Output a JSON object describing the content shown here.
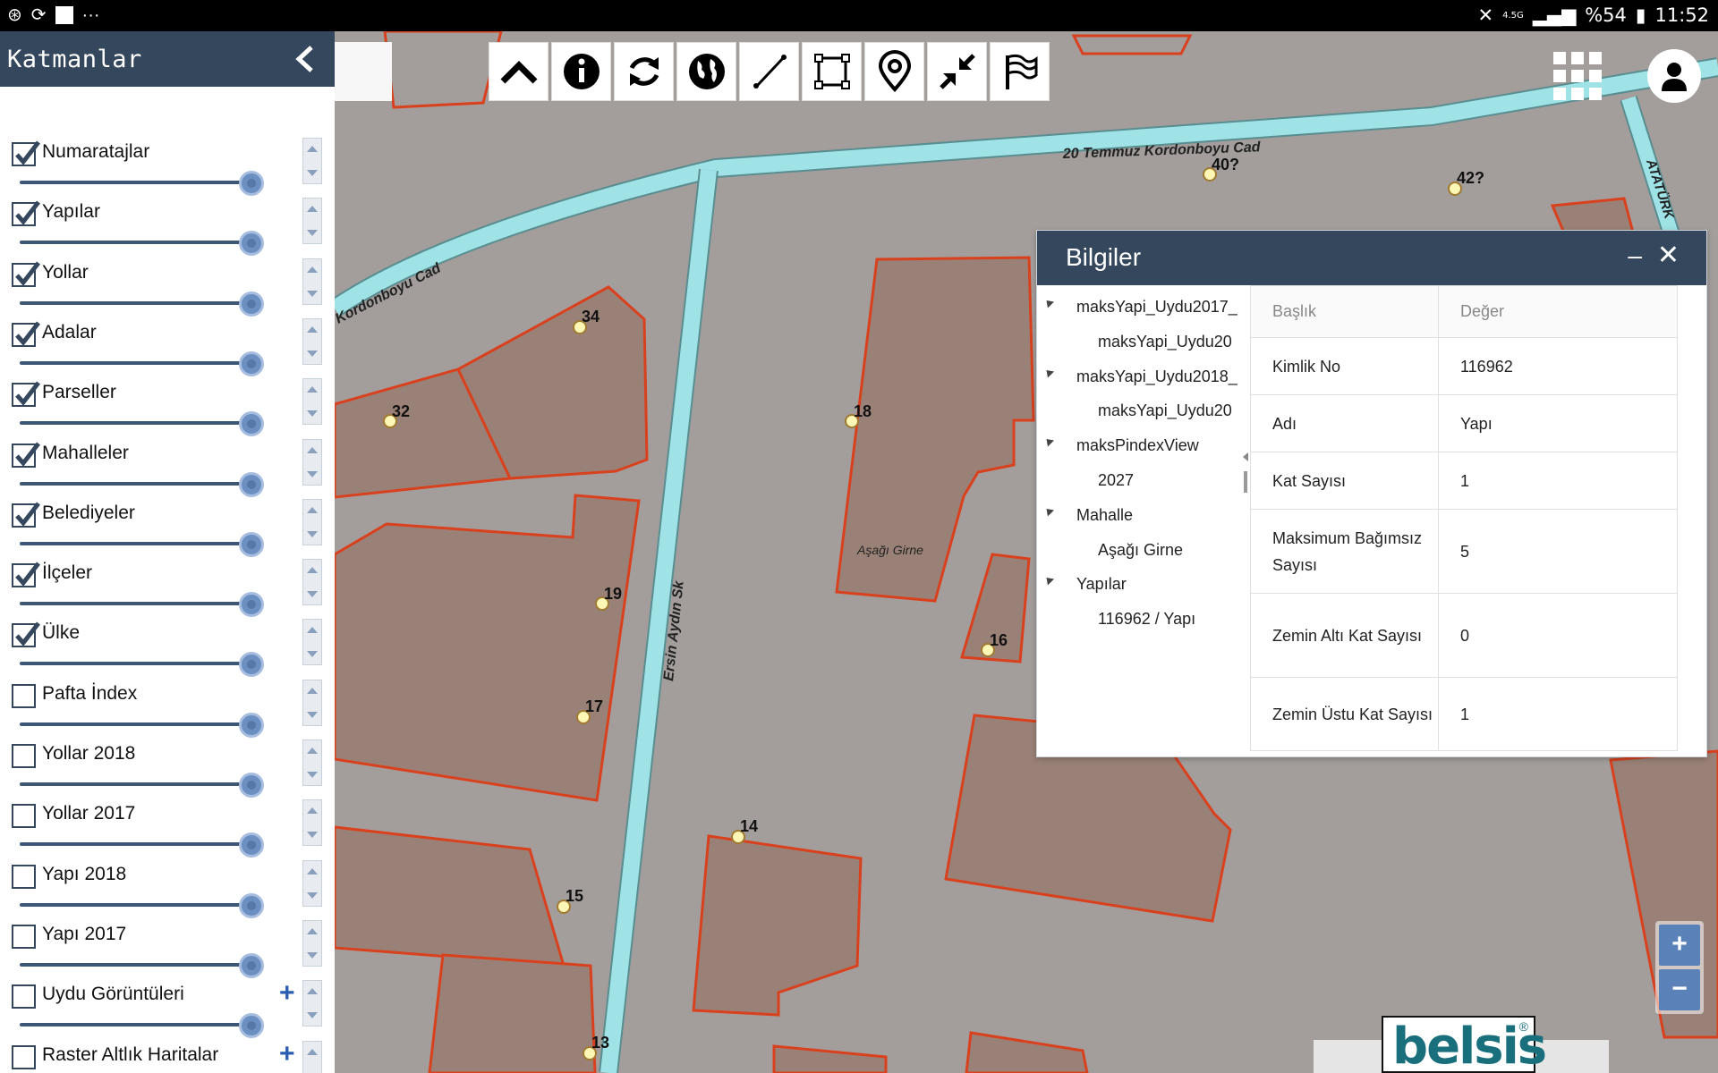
{
  "status_bar": {
    "left_icons": [
      "tethering-icon",
      "sync-icon",
      "flipboard-icon",
      "more-icon"
    ],
    "network": "4.5G",
    "battery": "%54",
    "time": "11:52"
  },
  "layers_panel": {
    "title": "Katmanlar",
    "items": [
      {
        "label": "Numaratajlar",
        "checked": true
      },
      {
        "label": "Yapılar",
        "checked": true
      },
      {
        "label": "Yollar",
        "checked": true
      },
      {
        "label": "Adalar",
        "checked": true
      },
      {
        "label": "Parseller",
        "checked": true
      },
      {
        "label": "Mahalleler",
        "checked": true
      },
      {
        "label": "Belediyeler",
        "checked": true
      },
      {
        "label": "İlçeler",
        "checked": true
      },
      {
        "label": "Ülke",
        "checked": true
      },
      {
        "label": "Pafta İndex",
        "checked": false
      },
      {
        "label": "Yollar 2018",
        "checked": false
      },
      {
        "label": "Yollar 2017",
        "checked": false
      },
      {
        "label": "Yapı 2018",
        "checked": false
      },
      {
        "label": "Yapı 2017",
        "checked": false
      },
      {
        "label": "Uydu Görüntüleri",
        "checked": false,
        "expandable": true
      },
      {
        "label": "Raster Altlık Haritalar",
        "checked": false,
        "expandable": true
      }
    ]
  },
  "toolbar": {
    "tools": [
      "collapse-up-icon",
      "info-icon",
      "refresh-icon",
      "globe-icon",
      "measure-line-icon",
      "select-area-icon",
      "location-pin-icon",
      "shrink-icon",
      "flag-icon"
    ]
  },
  "map": {
    "street_labels": [
      "20 Temmuz Kordonboyu Cad",
      "Kordonboyu Cad",
      "Ersin Aydın Sk",
      "ATATÜRK"
    ],
    "area_label": "Aşağı Girne",
    "house_numbers": [
      "34",
      "32",
      "18",
      "19",
      "17",
      "16",
      "14",
      "15",
      "13",
      "40?",
      "42?"
    ]
  },
  "info_panel": {
    "title": "Bilgiler",
    "tree": [
      {
        "label": "maksYapi_Uydu2017_",
        "level": 0
      },
      {
        "label": "maksYapi_Uydu20",
        "level": 1
      },
      {
        "label": "maksYapi_Uydu2018_",
        "level": 0
      },
      {
        "label": "maksYapi_Uydu20",
        "level": 1
      },
      {
        "label": "maksPindexView",
        "level": 0
      },
      {
        "label": "2027",
        "level": 1
      },
      {
        "label": "Mahalle",
        "level": 0
      },
      {
        "label": "Aşağı Girne",
        "level": 1
      },
      {
        "label": "Yapılar",
        "level": 0
      },
      {
        "label": "116962 / Yapı",
        "level": 1
      }
    ],
    "table": {
      "headers": [
        "Başlık",
        "Değer"
      ],
      "rows": [
        {
          "key": "Kimlik No",
          "value": "116962"
        },
        {
          "key": "Adı",
          "value": "Yapı"
        },
        {
          "key": "Kat Sayısı",
          "value": "1"
        },
        {
          "key": "Maksimum Bağımsız Sayısı",
          "value": "5"
        },
        {
          "key": "Zemin Altı Kat Sayısı",
          "value": "0"
        },
        {
          "key": "Zemin Üstu Kat Sayısı",
          "value": "1"
        }
      ]
    }
  },
  "zoom": {
    "in": "+",
    "out": "−"
  },
  "logo": {
    "text": "belsis",
    "mark": "®"
  },
  "colors": {
    "panel_header": "#35475d",
    "road": "#9fe3e6",
    "building": "#9a8177",
    "parcel_border": "#d9411e"
  }
}
